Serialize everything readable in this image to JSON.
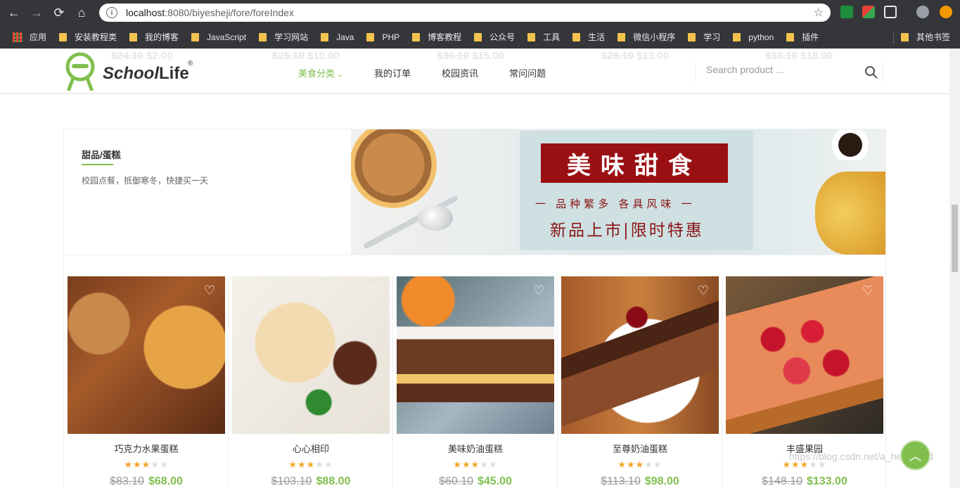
{
  "browser": {
    "url_host": "localhost",
    "url_rest": ":8080/biyesheji/fore/foreIndex",
    "bookmarks": [
      "应用",
      "安装教程类",
      "我的博客",
      "JavaScript",
      "学习网站",
      "Java",
      "PHP",
      "博客教程",
      "公众号",
      "工具",
      "生活",
      "微信小程序",
      "学习",
      "python",
      "插件"
    ],
    "other_bookmarks": "其他书签"
  },
  "ghost_prices": [
    {
      "old": "$24.10",
      "new": "$2.00"
    },
    {
      "old": "$25.10",
      "new": "$10.00"
    },
    {
      "old": "$30.10",
      "new": "$15.00"
    },
    {
      "old": "$28.10",
      "new": "$13.00"
    },
    {
      "old": "$33.10",
      "new": "$18.00"
    }
  ],
  "header": {
    "logo_school": "School",
    "logo_life": "Life",
    "logo_reg": "®",
    "menu": [
      "美食分类",
      "我的订单",
      "校园资讯",
      "常问问题"
    ],
    "search_placeholder": "Search product ..."
  },
  "banner": {
    "category_title": "甜品/蛋糕",
    "category_desc": "校园点餐，抵御寒冬，快捷买一天",
    "promo_title": "美味甜食",
    "promo_sub": "一 品种繁多  各具风味 一",
    "promo_tag": "新品上市|限时特惠"
  },
  "products": [
    {
      "name": "巧克力水果蛋糕",
      "rating": 3,
      "old_price": "$83.10",
      "new_price": "$68.00"
    },
    {
      "name": "心心相印",
      "rating": 3,
      "old_price": "$103.10",
      "new_price": "$88.00"
    },
    {
      "name": "美味奶油蛋糕",
      "rating": 3,
      "old_price": "$60.10",
      "new_price": "$45.00"
    },
    {
      "name": "至尊奶油蛋糕",
      "rating": 3,
      "old_price": "$113.10",
      "new_price": "$98.00"
    },
    {
      "name": "丰盛果园",
      "rating": 3,
      "old_price": "$148.10",
      "new_price": "$133.00"
    }
  ],
  "watermark": "https://blog.csdn.net/a_helloword",
  "colors": {
    "accent": "#80bf4e",
    "promo_red": "#9a0f12"
  }
}
